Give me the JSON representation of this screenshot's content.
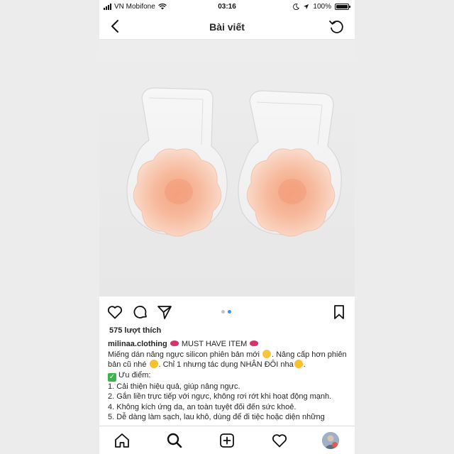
{
  "status_bar": {
    "carrier": "VN Mobifone",
    "time": "03:16",
    "battery": "100%",
    "battery_level": 1.0
  },
  "nav": {
    "title": "Bài viết",
    "back_icon": "chevron-left-icon",
    "refresh_icon": "refresh-icon"
  },
  "carousel": {
    "count": 2,
    "active_index": 1
  },
  "post": {
    "likes": "575 lượt thích",
    "username": "milinaa.clothing",
    "caption_head": "MUST HAVE ITEM",
    "line1": "Miếng dán nâng ngực silicon phiên bản mới",
    "line1b": ". Nâng cấp hơn phiên bản cũ nhé",
    "line1c": ". Chỉ 1 nhưng tác dụng NHÂN ĐÔI nha",
    "advantages_title": "Ưu điểm:",
    "items": [
      "1. Cải thiện hiệu quả, giúp nâng ngực.",
      "2. Gắn liền trực tiếp với ngực, không rơi rớt khi hoạt động mạnh.",
      "4. Không kích ứng da, an toàn tuyệt đối đến sức khoẻ.",
      "5. Dễ dàng làm sạch, lau khô, dùng để đi tiệc hoặc diện những"
    ]
  },
  "colors": {
    "accent": "#3897f0",
    "lips": "#d6336c",
    "check": "#3bb54a"
  }
}
